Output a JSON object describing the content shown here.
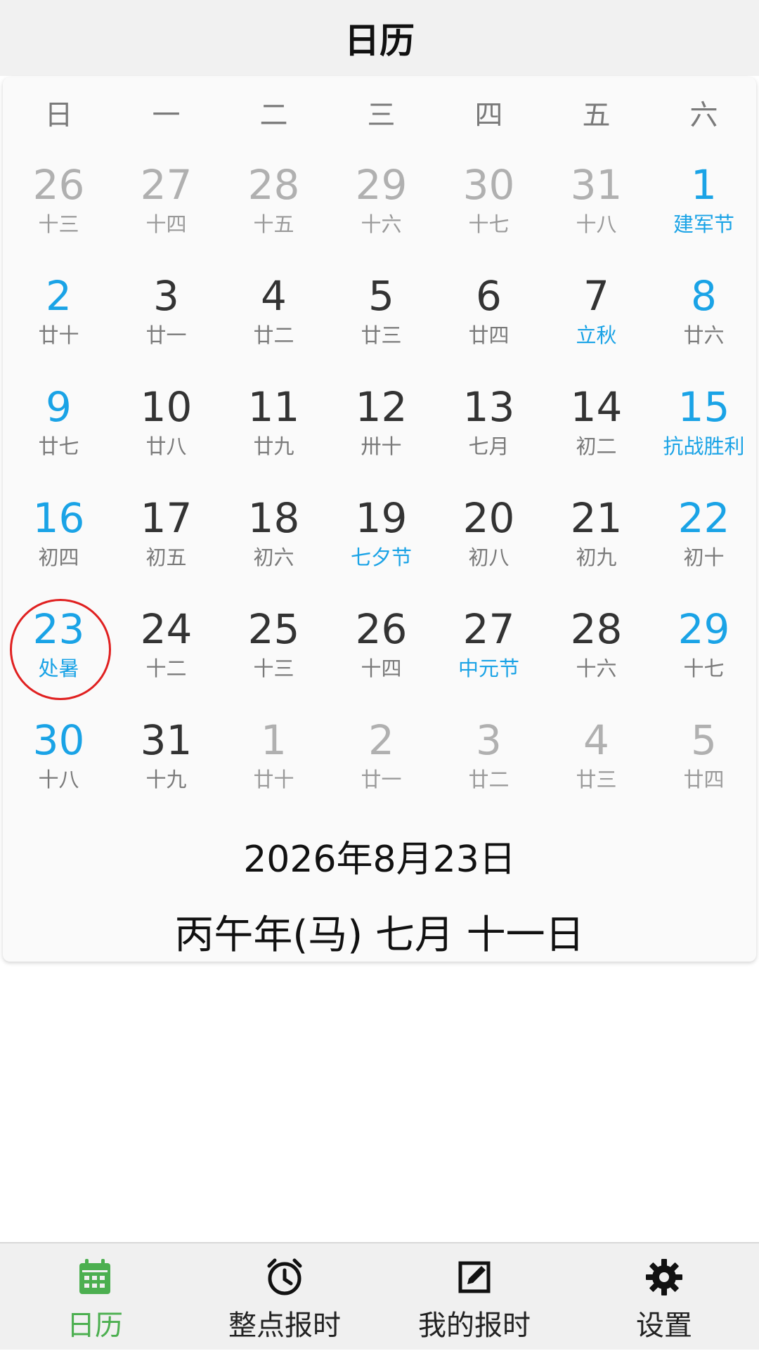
{
  "header": {
    "title": "日历"
  },
  "weekdays": [
    "日",
    "一",
    "二",
    "三",
    "四",
    "五",
    "六"
  ],
  "calendar": {
    "weeks": [
      [
        {
          "day": "26",
          "sub": "十三",
          "kind": "other"
        },
        {
          "day": "27",
          "sub": "十四",
          "kind": "other"
        },
        {
          "day": "28",
          "sub": "十五",
          "kind": "other"
        },
        {
          "day": "29",
          "sub": "十六",
          "kind": "other"
        },
        {
          "day": "30",
          "sub": "十七",
          "kind": "other"
        },
        {
          "day": "31",
          "sub": "十八",
          "kind": "other"
        },
        {
          "day": "1",
          "sub": "建军节",
          "kind": "weekend",
          "holiday": true
        }
      ],
      [
        {
          "day": "2",
          "sub": "廿十",
          "kind": "weekend"
        },
        {
          "day": "3",
          "sub": "廿一"
        },
        {
          "day": "4",
          "sub": "廿二"
        },
        {
          "day": "5",
          "sub": "廿三"
        },
        {
          "day": "6",
          "sub": "廿四"
        },
        {
          "day": "7",
          "sub": "立秋",
          "holiday": true
        },
        {
          "day": "8",
          "sub": "廿六",
          "kind": "weekend"
        }
      ],
      [
        {
          "day": "9",
          "sub": "廿七",
          "kind": "weekend"
        },
        {
          "day": "10",
          "sub": "廿八"
        },
        {
          "day": "11",
          "sub": "廿九"
        },
        {
          "day": "12",
          "sub": "卅十"
        },
        {
          "day": "13",
          "sub": "七月"
        },
        {
          "day": "14",
          "sub": "初二"
        },
        {
          "day": "15",
          "sub": "抗战胜利",
          "kind": "weekend",
          "holiday": true
        }
      ],
      [
        {
          "day": "16",
          "sub": "初四",
          "kind": "weekend"
        },
        {
          "day": "17",
          "sub": "初五"
        },
        {
          "day": "18",
          "sub": "初六"
        },
        {
          "day": "19",
          "sub": "七夕节",
          "holiday": true
        },
        {
          "day": "20",
          "sub": "初八"
        },
        {
          "day": "21",
          "sub": "初九"
        },
        {
          "day": "22",
          "sub": "初十",
          "kind": "weekend"
        }
      ],
      [
        {
          "day": "23",
          "sub": "处暑",
          "kind": "selected"
        },
        {
          "day": "24",
          "sub": "十二"
        },
        {
          "day": "25",
          "sub": "十三"
        },
        {
          "day": "26",
          "sub": "十四"
        },
        {
          "day": "27",
          "sub": "中元节",
          "holiday": true
        },
        {
          "day": "28",
          "sub": "十六"
        },
        {
          "day": "29",
          "sub": "十七",
          "kind": "weekend"
        }
      ],
      [
        {
          "day": "30",
          "sub": "十八",
          "kind": "weekend"
        },
        {
          "day": "31",
          "sub": "十九"
        },
        {
          "day": "1",
          "sub": "廿十",
          "kind": "other"
        },
        {
          "day": "2",
          "sub": "廿一",
          "kind": "other"
        },
        {
          "day": "3",
          "sub": "廿二",
          "kind": "other"
        },
        {
          "day": "4",
          "sub": "廿三",
          "kind": "other"
        },
        {
          "day": "5",
          "sub": "廿四",
          "kind": "other"
        }
      ]
    ]
  },
  "selected": {
    "date_text": "2026年8月23日",
    "lunar_text": "丙午年(马) 七月 十一日"
  },
  "colors": {
    "accent": "#1aa3e6",
    "selected_ring": "#e02020",
    "active_tab": "#4caf50"
  },
  "bottom_nav": [
    {
      "label": "日历",
      "icon": "calendar-icon",
      "active": true
    },
    {
      "label": "整点报时",
      "icon": "alarm-clock-icon"
    },
    {
      "label": "我的报时",
      "icon": "edit-note-icon"
    },
    {
      "label": "设置",
      "icon": "gear-icon"
    }
  ]
}
